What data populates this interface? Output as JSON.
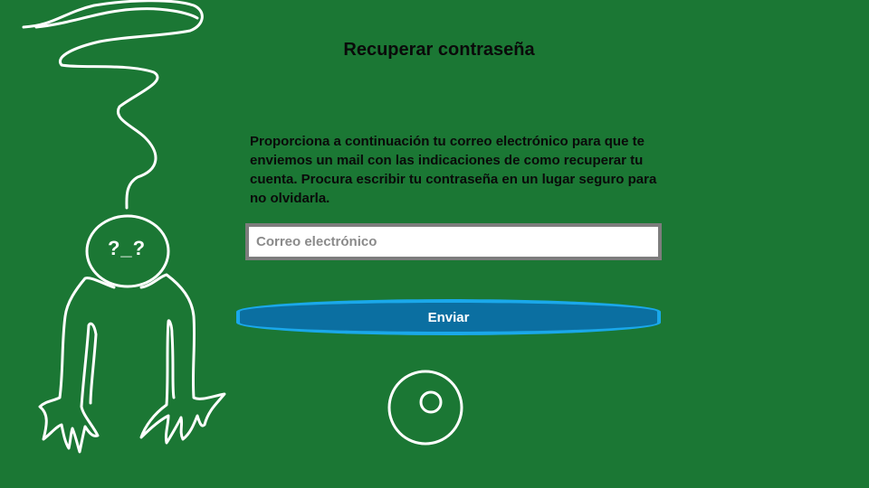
{
  "page": {
    "title": "Recuperar contraseña",
    "description": "Proporciona a continuación tu correo electrónico para que te enviemos un mail con las indicaciones de como recuperar tu cuenta. Procura escribir tu contraseña en un lugar seguro para no olvidarla."
  },
  "form": {
    "email_placeholder": "Correo electrónico",
    "email_value": "",
    "submit_label": "Enviar"
  },
  "doodle": {
    "face_text": "?_?"
  },
  "colors": {
    "background": "#1b7734",
    "input_border": "#7d7d7d",
    "button_fill": "#0b6fa1",
    "button_border": "#1aa8ea",
    "doodle_stroke": "#ffffff"
  },
  "icons": {
    "loading_indicator": "ring-icon"
  }
}
